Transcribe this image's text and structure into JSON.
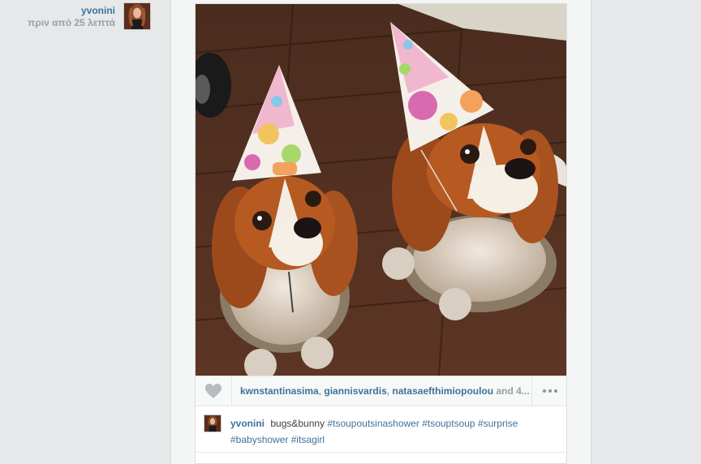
{
  "colors": {
    "link": "#3f729b",
    "muted": "#9aa0a4",
    "page_bg": "#e8eaeb",
    "card_bg": "#ffffff"
  },
  "post": {
    "author": "yvonini",
    "time_ago": "πριν από 25 λεπτά",
    "avatar_icon": "user-avatar",
    "photo_icon": "photo"
  },
  "actions": {
    "like_icon": "heart-icon",
    "likers": [
      "kwnstantinasima",
      "giannisvardis",
      "natasaefthimiopoulou"
    ],
    "likers_suffix": "and 4..."
  },
  "more_icon": "ellipsis-icon",
  "caption": {
    "author": "yvonini",
    "text": "bugs&bunny",
    "hashtags": [
      "#tsoupoutsinashower",
      "#tsouptsoup",
      "#surprise",
      "#babyshower",
      "#itsagirl"
    ]
  }
}
